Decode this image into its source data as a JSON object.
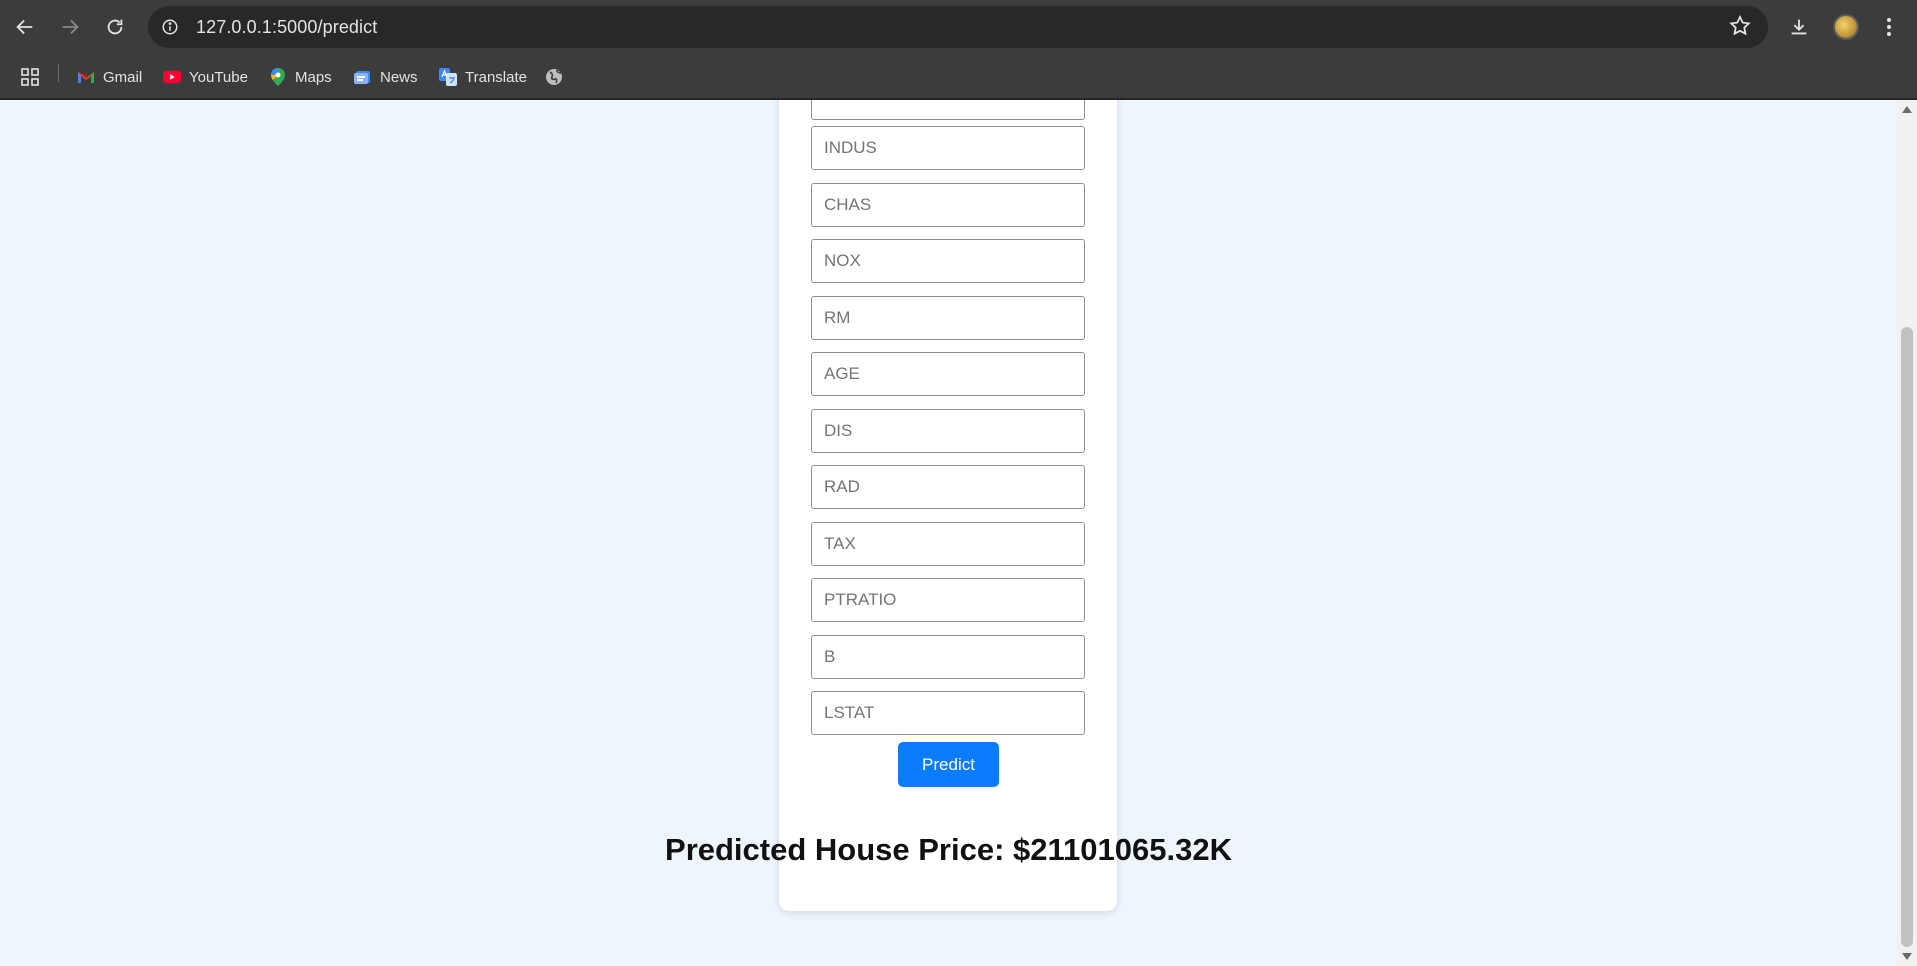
{
  "browser": {
    "url": "127.0.0.1:5000/predict",
    "bookmarks": [
      {
        "label": "Gmail",
        "icon": "gmail-icon"
      },
      {
        "label": "YouTube",
        "icon": "youtube-icon"
      },
      {
        "label": "Maps",
        "icon": "maps-icon"
      },
      {
        "label": "News",
        "icon": "news-icon"
      },
      {
        "label": "Translate",
        "icon": "translate-icon"
      }
    ]
  },
  "form": {
    "fields": [
      {
        "placeholder": "",
        "value": ""
      },
      {
        "placeholder": "INDUS",
        "value": ""
      },
      {
        "placeholder": "CHAS",
        "value": ""
      },
      {
        "placeholder": "NOX",
        "value": ""
      },
      {
        "placeholder": "RM",
        "value": ""
      },
      {
        "placeholder": "AGE",
        "value": ""
      },
      {
        "placeholder": "DIS",
        "value": ""
      },
      {
        "placeholder": "RAD",
        "value": ""
      },
      {
        "placeholder": "TAX",
        "value": ""
      },
      {
        "placeholder": "PTRATIO",
        "value": ""
      },
      {
        "placeholder": "B",
        "value": ""
      },
      {
        "placeholder": "LSTAT",
        "value": ""
      }
    ],
    "submit_label": "Predict"
  },
  "result": {
    "text": "Predicted House Price: $21101065.32K"
  },
  "colors": {
    "page_background": "#eef5fd",
    "button": "#0a7cff",
    "chrome": "#3c3c3c"
  }
}
